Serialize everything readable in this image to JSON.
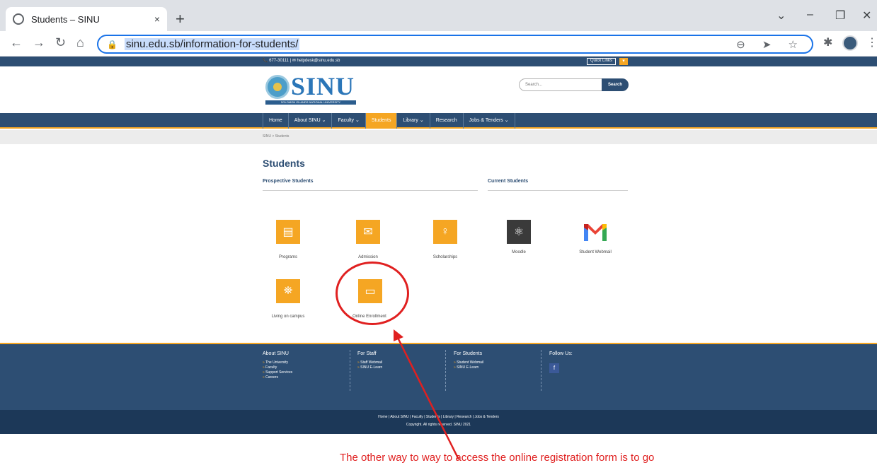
{
  "browser": {
    "tab_title": "Students – SINU",
    "tab_close": "×",
    "new_tab": "+",
    "url": "sinu.edu.sb/information-for-students/",
    "window_controls": [
      "⌄",
      "–",
      "❐",
      "✕"
    ]
  },
  "topbar": {
    "contact": "📞 677-30111  |  ✉ helpdesk@sinu.edu.sb",
    "quick_links": "Quick Links",
    "quick_links_arrow": "▾"
  },
  "logo": {
    "word": "SINU",
    "tagline": "SOLOMON ISLANDS NATIONAL UNIVERSITY"
  },
  "search": {
    "placeholder": "Search...",
    "button": "Search"
  },
  "nav": {
    "items": [
      {
        "label": "Home"
      },
      {
        "label": "About SINU ⌄"
      },
      {
        "label": "Faculty ⌄"
      },
      {
        "label": "Students"
      },
      {
        "label": "Library ⌄"
      },
      {
        "label": "Research"
      },
      {
        "label": "Jobs & Tenders ⌄"
      }
    ]
  },
  "breadcrumb": "SINU > Students",
  "page": {
    "title": "Students",
    "prospective_heading": "Prospective Students",
    "current_heading": "Current Students",
    "tiles": {
      "programs": "Programs",
      "admission": "Admission",
      "scholarships": "Scholarships",
      "moodle": "Moodle",
      "webmail": "Student Webmail",
      "living": "Living on campus",
      "enrollment": "Online Enrollment"
    }
  },
  "footer": {
    "about": {
      "heading": "About SINU",
      "links": [
        "The University",
        "Faculty",
        "Support Services",
        "Careers"
      ]
    },
    "staff": {
      "heading": "For Staff",
      "links": [
        "Staff Webmail",
        "SINU E-Learn"
      ]
    },
    "students": {
      "heading": "For Students",
      "links": [
        "Student Webmail",
        "SINU E-Learn"
      ]
    },
    "follow": {
      "heading": "Follow Us:",
      "fb": "f"
    },
    "bottom_links": "Home  |  About SINU  |  Faculty  |  Students  |  Library  |  Research  |  Jobs & Tenders",
    "copyright": "Copyright. All rights reserved. SINU 2021"
  },
  "annotation": {
    "text": "The other way to  way to access the online registration form is to go",
    "color": "#e02020"
  },
  "colors": {
    "navy": "#2d4e73",
    "orange": "#f5a623"
  }
}
